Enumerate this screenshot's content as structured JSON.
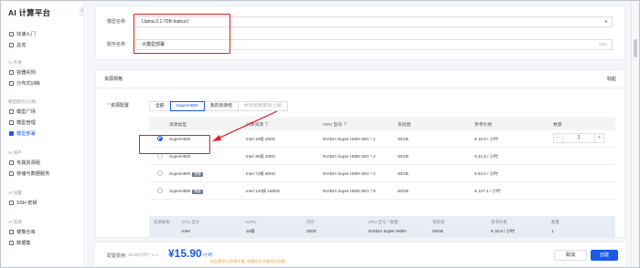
{
  "app": {
    "title": "AI 计算平台"
  },
  "sidebar": {
    "items": [
      {
        "label": "快速入门"
      },
      {
        "label": "总览"
      }
    ],
    "groups": [
      {
        "title": "AI 开发",
        "items": [
          {
            "label": "容器实例"
          },
          {
            "label": "分布式训练"
          }
        ]
      },
      {
        "title": "模型服务(公测)",
        "items": [
          {
            "label": "模型广场"
          },
          {
            "label": "模型管理"
          },
          {
            "label": "模型部署"
          }
        ]
      },
      {
        "title": "AI 资产",
        "items": [
          {
            "label": "专属资源组"
          },
          {
            "label": "存储与数据服务"
          }
        ]
      },
      {
        "title": "AI 设置",
        "items": [
          {
            "label": "SSH 密钥"
          }
        ]
      },
      {
        "title": "AI 资源",
        "items": [
          {
            "label": "镜像仓库"
          },
          {
            "label": "数据集"
          }
        ]
      }
    ],
    "active_item": "模型部署"
  },
  "form": {
    "model_name_label": "模型名称",
    "model_name_value": "Llama-3.1-70B-Instruct",
    "service_name_label": "服务名称",
    "service_name_value": "大模型部署",
    "service_name_count": "5/64"
  },
  "resources": {
    "section_title": "资源规格",
    "collapse_label": "收起",
    "config_label": "资源配置",
    "tabs": [
      "全部",
      "SuperH800",
      "我的资源组",
      "共享资源(即将上线)"
    ],
    "active_tab": "SuperH800",
    "columns": [
      "资源类型",
      "计算资源",
      "GPU 型号",
      "系统盘",
      "参考价格",
      "数量"
    ],
    "rows": [
      {
        "type": "SuperH800",
        "badge": "",
        "compute": "Intel 18核 200G",
        "gpu": "NVIDIA Super H800 80G * 1",
        "disk": "50GB",
        "price": "¥ 15.9 / 小时",
        "selected": true
      },
      {
        "type": "SuperH800",
        "badge": "",
        "compute": "Intel 36核 400G",
        "gpu": "NVIDIA Super H800 80G * 2",
        "disk": "50GB",
        "price": "¥ 31.8 / 小时",
        "selected": false
      },
      {
        "type": "SuperH800",
        "badge": "售罄",
        "compute": "Intel 72核 800G",
        "gpu": "NVIDIA Super H800 80G * 4",
        "disk": "50GB",
        "price": "¥ 63.6 / 小时",
        "selected": false
      },
      {
        "type": "SuperH800",
        "badge": "售罄",
        "compute": "Intel 144核 1600G",
        "gpu": "NVIDIA Super H800 80G * 8",
        "disk": "50GB",
        "price": "¥ 127.2 / 小时",
        "selected": false
      }
    ],
    "quantity": {
      "minus": "−",
      "value": "1",
      "plus": "+"
    },
    "summary": {
      "label": "资源规格:",
      "headers": [
        "CPU 型号",
        "vCPU",
        "内存",
        "GPU 型号 * 数量",
        "系统盘",
        "参考价格",
        "数量"
      ],
      "values": [
        "Intel",
        "18核",
        "200G",
        "NVIDIA Super H800-",
        "50GB",
        "¥ 15.9 / 小时",
        "1"
      ]
    }
  },
  "footer": {
    "fee_label": "配置费用:",
    "formula": "15.90/小时 * 1 = ",
    "price": "¥15.90",
    "unit": "/小时",
    "note": "实际费用以账单为准, 余额充足才能成功创建",
    "cancel_label": "取消",
    "create_label": "创建"
  },
  "colors": {
    "accent": "#1a5ae6",
    "highlight": "#e0201e"
  }
}
